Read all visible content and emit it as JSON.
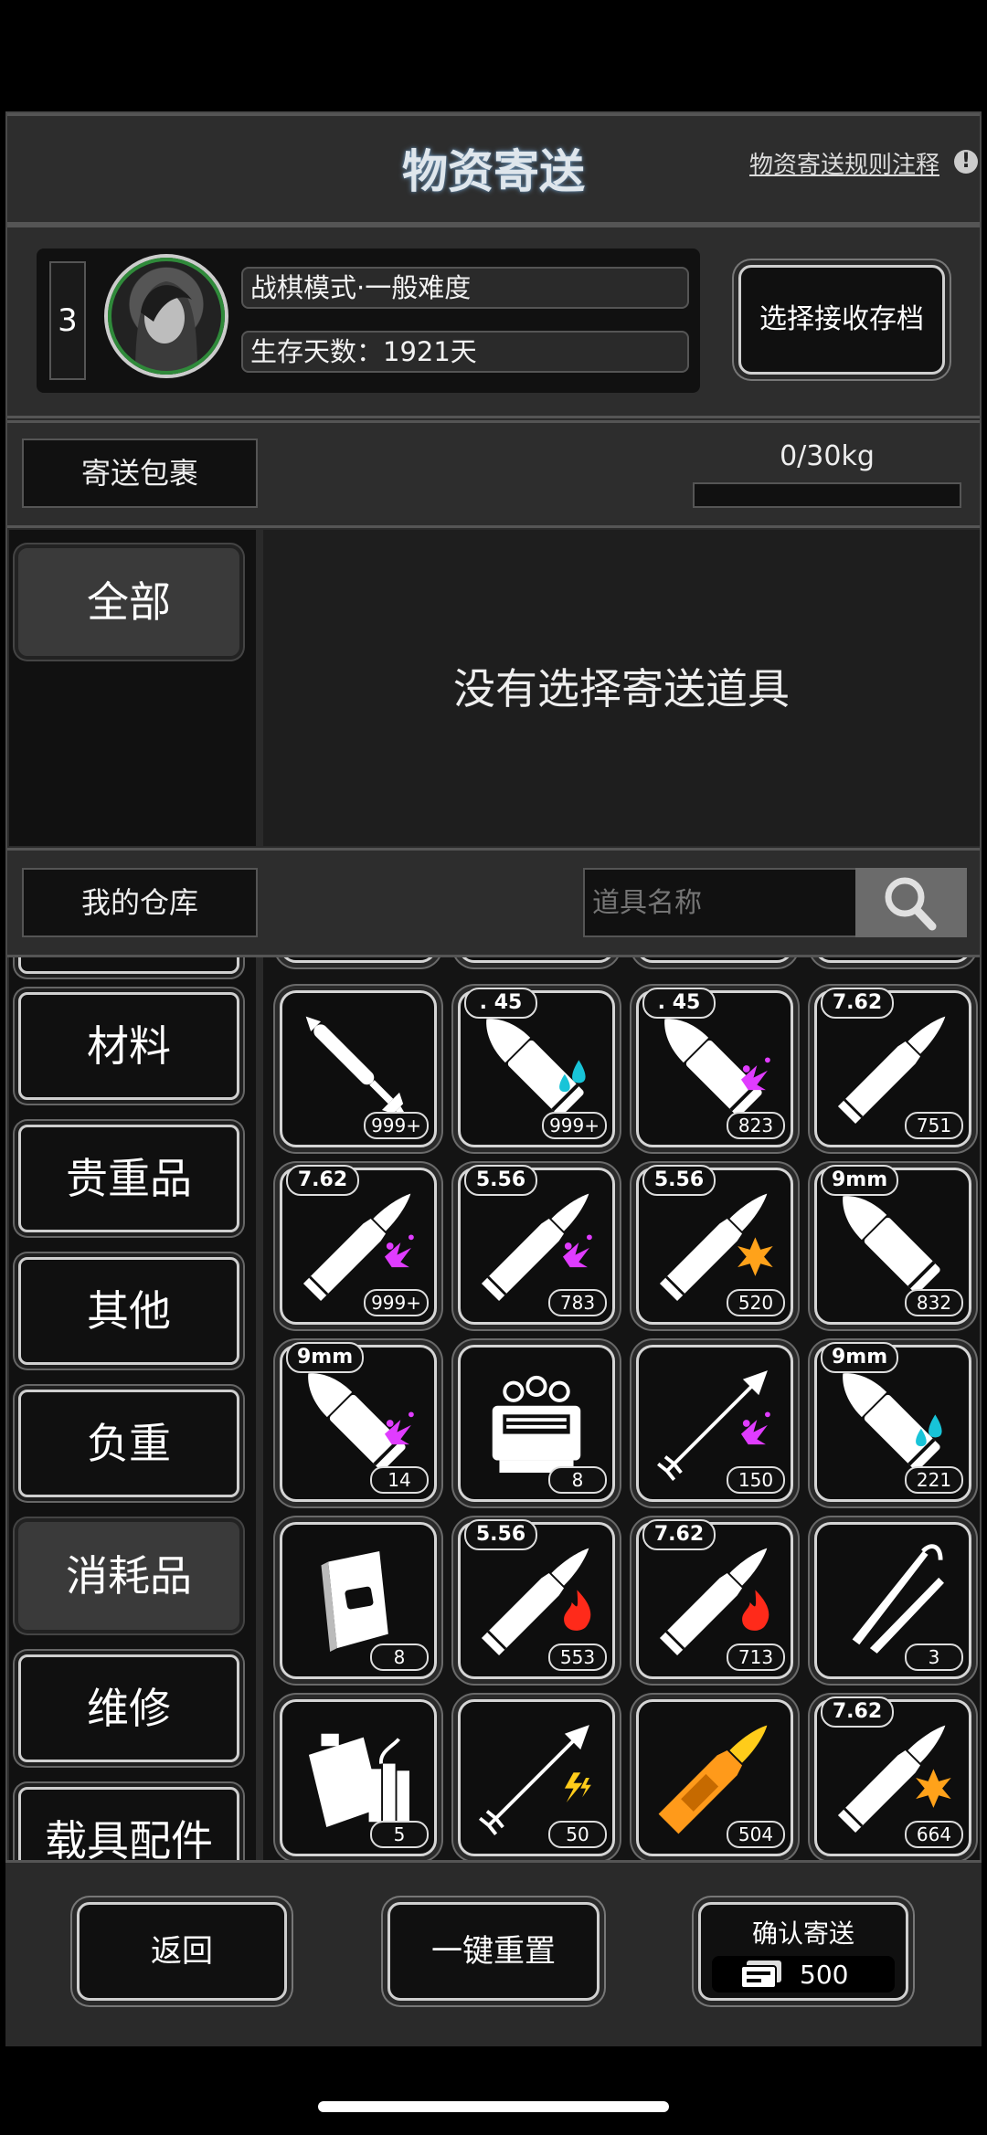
{
  "header": {
    "title": "物资寄送",
    "rules_link": "物资寄送规则注释",
    "info_glyph": "!"
  },
  "save": {
    "level": "3",
    "mode": "战棋模式·一般难度",
    "days": "生存天数：1921天",
    "select_button": "选择接收存档"
  },
  "package": {
    "label": "寄送包裹",
    "weight": "0/30kg",
    "weight_fraction": 0,
    "empty_message": "没有选择寄送道具"
  },
  "package_categories": [
    {
      "label": "全部",
      "active": true
    }
  ],
  "warehouse": {
    "label": "我的仓库",
    "search_placeholder": "道具名称"
  },
  "categories": [
    {
      "label": "材料",
      "active": false
    },
    {
      "label": "贵重品",
      "active": false
    },
    {
      "label": "其他",
      "active": false
    },
    {
      "label": "负重",
      "active": false
    },
    {
      "label": "消耗品",
      "active": true
    },
    {
      "label": "维修",
      "active": false
    },
    {
      "label": "载具配件",
      "active": false
    }
  ],
  "items": [
    {
      "icon": "rocket-icon",
      "caliber": "",
      "count": "999+",
      "badge": ""
    },
    {
      "icon": "bullet-icon",
      "caliber": ". 45",
      "count": "999+",
      "badge": "water-drops-icon"
    },
    {
      "icon": "bullet-icon",
      "caliber": ". 45",
      "count": "823",
      "badge": "acid-splash-icon"
    },
    {
      "icon": "rifle-round-icon",
      "caliber": "7.62",
      "count": "751",
      "badge": ""
    },
    {
      "icon": "rifle-round-icon",
      "caliber": "7.62",
      "count": "999+",
      "badge": "acid-splash-icon"
    },
    {
      "icon": "rifle-round-icon",
      "caliber": "5.56",
      "count": "783",
      "badge": "acid-splash-icon"
    },
    {
      "icon": "rifle-round-icon",
      "caliber": "5.56",
      "count": "520",
      "badge": "explosion-icon"
    },
    {
      "icon": "bullet-icon",
      "caliber": "9mm",
      "count": "832",
      "badge": ""
    },
    {
      "icon": "bullet-icon",
      "caliber": "9mm",
      "count": "14",
      "badge": "acid-splash-icon"
    },
    {
      "icon": "machine-part-icon",
      "caliber": "",
      "count": "8",
      "badge": ""
    },
    {
      "icon": "arrow-icon",
      "caliber": "",
      "count": "150",
      "badge": "acid-splash-icon"
    },
    {
      "icon": "bullet-icon",
      "caliber": "9mm",
      "count": "221",
      "badge": "water-drops-icon"
    },
    {
      "icon": "book-icon",
      "caliber": "",
      "count": "8",
      "badge": ""
    },
    {
      "icon": "rifle-round-icon",
      "caliber": "5.56",
      "count": "553",
      "badge": "fire-icon"
    },
    {
      "icon": "rifle-round-icon",
      "caliber": "7.62",
      "count": "713",
      "badge": "fire-icon"
    },
    {
      "icon": "tweezers-icon",
      "caliber": "",
      "count": "3",
      "badge": ""
    },
    {
      "icon": "fuel-can-explosives-icon",
      "caliber": "",
      "count": "5",
      "badge": ""
    },
    {
      "icon": "arrow-icon",
      "caliber": "",
      "count": "50",
      "badge": "lightning-icon"
    },
    {
      "icon": "golden-round-icon",
      "caliber": "",
      "count": "504",
      "badge": ""
    },
    {
      "icon": "rifle-round-icon",
      "caliber": "7.62",
      "count": "664",
      "badge": "explosion-icon"
    }
  ],
  "footer": {
    "back_button": "返回",
    "reset_button": "一键重置",
    "confirm_button": "确认寄送",
    "cost": "500",
    "cost_icon": "ticket-icon"
  },
  "colors": {
    "acid": "#e03cff",
    "water": "#18c4d8",
    "fire": "#ff2a1a",
    "explosion": "#ffa21a",
    "lightning": "#ffcc1a",
    "gold": "#ff9a1a"
  }
}
